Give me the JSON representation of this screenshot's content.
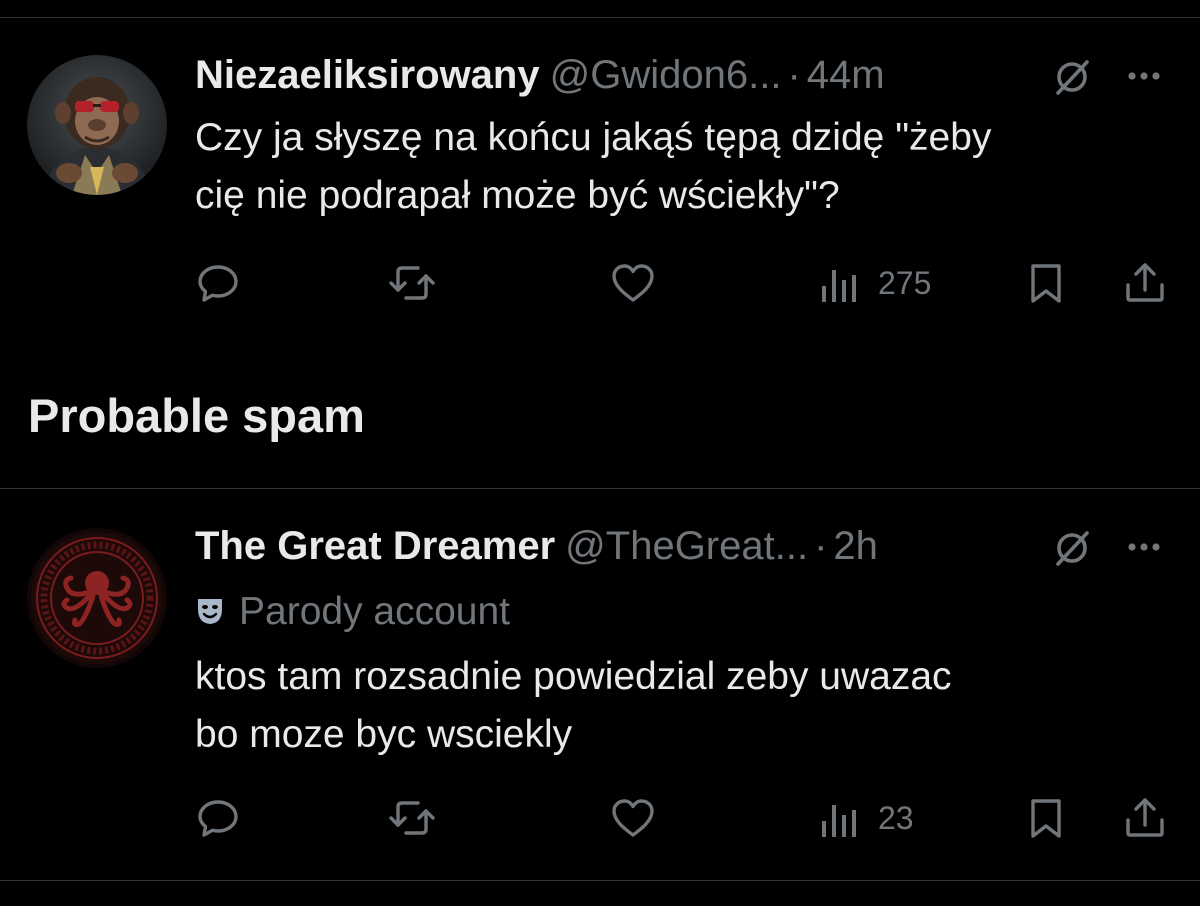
{
  "colors": {
    "background": "#000000",
    "text_primary": "#e7e9ea",
    "text_secondary": "#71767b",
    "divider": "#2f3336"
  },
  "posts": [
    {
      "display_name": "Niezaeliksirowany",
      "handle": "@Gwidon6...",
      "separator": "·",
      "time": "44m",
      "avatar_icon": "chimpanzee-avatar",
      "text_lines": [
        "Czy ja słyszę na końcu jakąś tępą dzidę \"żeby",
        "cię nie podrapał może być wściekły\"?"
      ],
      "views": "275"
    },
    {
      "display_name": "The Great Dreamer",
      "handle": "@TheGreat...",
      "separator": "·",
      "time": "2h",
      "avatar_icon": "octopus-emblem-avatar",
      "badge_label": "Parody account",
      "text_lines": [
        "ktos tam rozsadnie powiedzial zeby uwazac",
        "bo moze byc wsciekly"
      ],
      "views": "23"
    }
  ],
  "section": {
    "title": "Probable spam"
  }
}
